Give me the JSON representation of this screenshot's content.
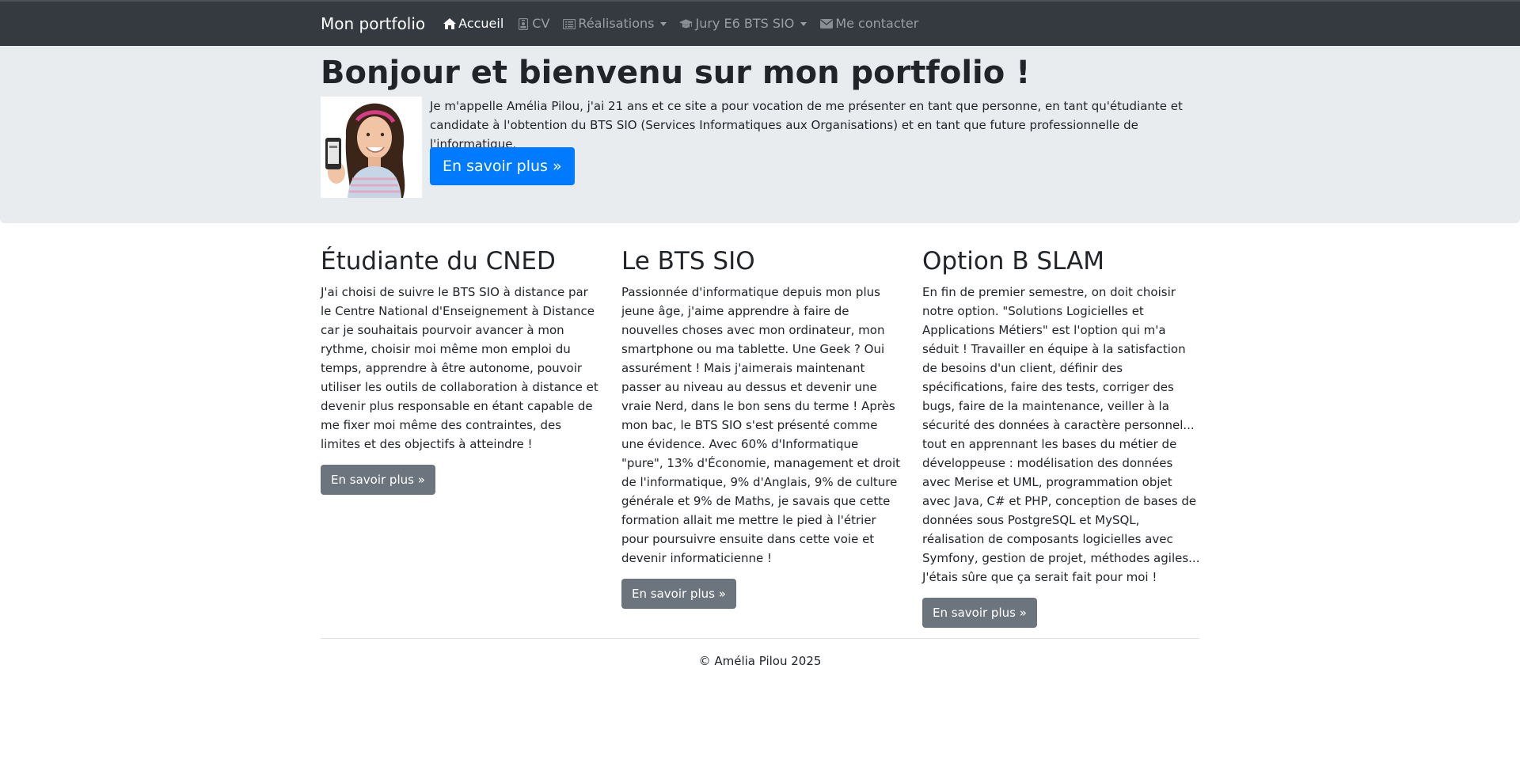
{
  "navbar": {
    "brand": "Mon portfolio",
    "items": [
      {
        "label": "Accueil",
        "icon": "home-icon",
        "active": true,
        "dropdown": false
      },
      {
        "label": "CV",
        "icon": "id-badge-icon",
        "active": false,
        "dropdown": false
      },
      {
        "label": "Réalisations",
        "icon": "list-alt-icon",
        "active": false,
        "dropdown": true
      },
      {
        "label": "Jury E6 BTS SIO",
        "icon": "graduation-cap-icon",
        "active": false,
        "dropdown": true
      },
      {
        "label": "Me contacter",
        "icon": "envelope-icon",
        "active": false,
        "dropdown": false
      }
    ]
  },
  "jumbotron": {
    "title": "Bonjour et bienvenu sur mon portfolio !",
    "intro": "Je m'appelle Amélia Pilou, j'ai 21 ans et ce site a pour vocation de me présenter en tant que personne, en tant qu'étudiante et candidate à l'obtention du BTS SIO (Services Informatiques aux Organisations) et en tant que future professionnelle de l'informatique.",
    "button_label": "En savoir plus »"
  },
  "columns": [
    {
      "title": "Étudiante du CNED",
      "text": "J'ai choisi de suivre le BTS SIO à distance par le Centre National d'Enseignement à Distance car je souhaitais pourvoir avancer à mon rythme, choisir moi même mon emploi du temps, apprendre à être autonome, pouvoir utiliser les outils de collaboration à distance et devenir plus responsable en étant capable de me fixer moi même des contraintes, des limites et des objectifs à atteindre !",
      "button_label": "En savoir plus »"
    },
    {
      "title": "Le BTS SIO",
      "text": "Passionnée d'informatique depuis mon plus jeune âge, j'aime apprendre à faire de nouvelles choses avec mon ordinateur, mon smartphone ou ma tablette. Une Geek ? Oui assurément ! Mais j'aimerais maintenant passer au niveau au dessus et devenir une vraie Nerd, dans le bon sens du terme ! Après mon bac, le BTS SIO s'est présenté comme une évidence. Avec 60% d'Informatique \"pure\", 13% d'Économie, management et droit de l'informatique, 9% d'Anglais, 9% de culture générale et 9% de Maths, je savais que cette formation allait me mettre le pied à l'étrier pour poursuivre ensuite dans cette voie et devenir informaticienne !",
      "button_label": "En savoir plus »"
    },
    {
      "title": "Option B SLAM",
      "text": "En fin de premier semestre, on doit choisir notre option. \"Solutions Logicielles et Applications Métiers\" est l'option qui m'a séduit ! Travailler en équipe à la satisfaction de besoins d'un client, définir des spécifications, faire des tests, corriger des bugs, faire de la maintenance, veiller à la sécurité des données à caractère personnel... tout en apprennant les bases du métier de développeuse : modélisation des données avec Merise et UML, programmation objet avec Java, C# et PHP, conception de bases de données sous PostgreSQL et MySQL, réalisation de composants logicielles avec Symfony, gestion de projet, méthodes agiles... J'étais sûre que ça serait fait pour moi !",
      "button_label": "En savoir plus »"
    }
  ],
  "footer": {
    "text": "© Amélia Pilou 2025"
  },
  "colors": {
    "navbar_bg": "#343a40",
    "jumbotron_bg": "#e9ecef",
    "primary": "#007bff",
    "secondary": "#6c757d"
  }
}
